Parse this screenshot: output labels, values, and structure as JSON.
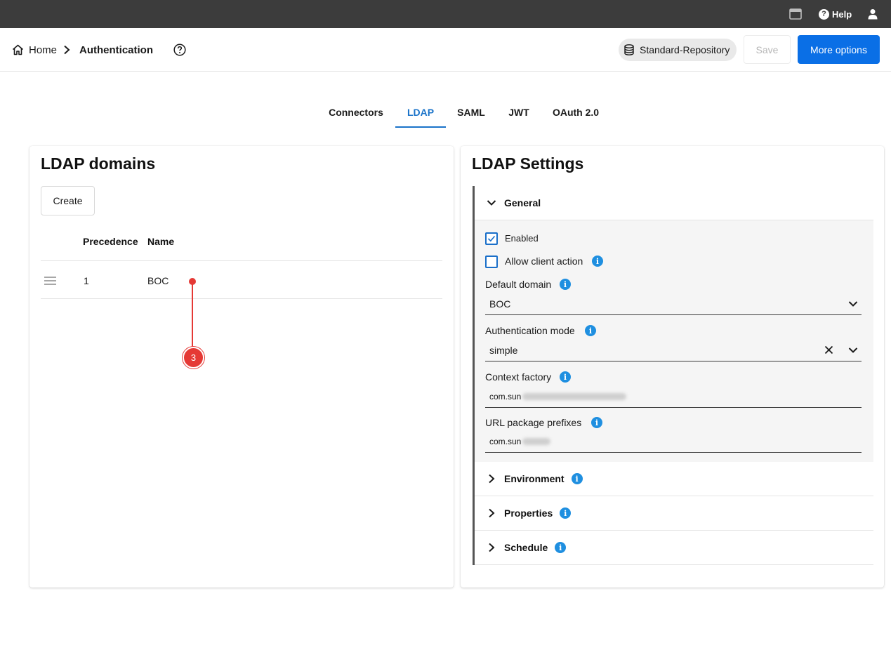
{
  "topbar": {
    "window_icon": "window-icon",
    "help_label": "Help",
    "user_icon": "user-icon"
  },
  "header": {
    "home_label": "Home",
    "current_page": "Authentication",
    "repository_label": "Standard-Repository",
    "save_label": "Save",
    "more_options_label": "More options"
  },
  "tabs": [
    {
      "label": "Connectors",
      "active": false
    },
    {
      "label": "LDAP",
      "active": true
    },
    {
      "label": "SAML",
      "active": false
    },
    {
      "label": "JWT",
      "active": false
    },
    {
      "label": "OAuth 2.0",
      "active": false
    }
  ],
  "domains": {
    "title": "LDAP domains",
    "create_label": "Create",
    "columns": [
      "Precedence",
      "Name"
    ],
    "rows": [
      {
        "precedence": "1",
        "name": "BOC"
      }
    ]
  },
  "callout": {
    "number": "3"
  },
  "settings": {
    "title": "LDAP Settings",
    "general": {
      "label": "General",
      "expanded": true,
      "enabled_label": "Enabled",
      "enabled_checked": true,
      "allow_client_action_label": "Allow client action",
      "allow_client_action_checked": false,
      "default_domain_label": "Default domain",
      "default_domain_value": "BOC",
      "auth_mode_label": "Authentication mode",
      "auth_mode_value": "simple",
      "context_factory_label": "Context factory",
      "context_factory_value": "com.sun",
      "url_prefixes_label": "URL package prefixes",
      "url_prefixes_value": "com.sun"
    },
    "environment_label": "Environment",
    "properties_label": "Properties",
    "schedule_label": "Schedule"
  },
  "colors": {
    "accent": "#0a6fe6",
    "tab_active": "#1a73c9",
    "info": "#1f8fe0",
    "callout": "#e53935",
    "topbar": "#3c3c3c"
  }
}
